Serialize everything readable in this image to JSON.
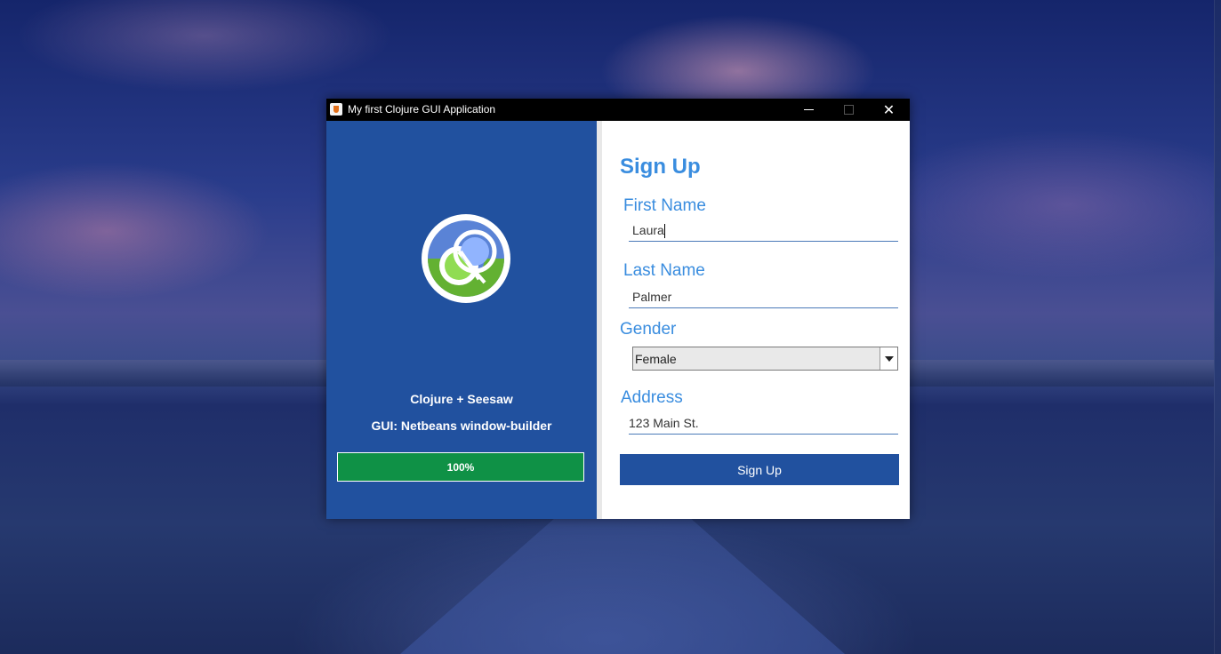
{
  "window": {
    "title": "My first Clojure GUI Application",
    "app_icon": "java-cup-icon",
    "controls": {
      "minimize_icon": "minimize-icon",
      "maximize_icon": "maximize-icon",
      "close_glyph": "✕"
    }
  },
  "left_panel": {
    "logo": "clojure-logo",
    "tagline_1": "Clojure + Seesaw",
    "tagline_2": "GUI: Netbeans window-builder",
    "progress": {
      "value": 100,
      "label": "100%"
    },
    "colors": {
      "background": "#21519f",
      "progress_fill": "#0f9146"
    }
  },
  "form": {
    "heading": "Sign Up",
    "first_name": {
      "label": "First Name",
      "value": "Laura"
    },
    "last_name": {
      "label": "Last Name",
      "value": "Palmer"
    },
    "gender": {
      "label": "Gender",
      "selected": "Female",
      "arrow_icon": "dropdown-arrow-icon"
    },
    "address": {
      "label": "Address",
      "value": "123 Main St."
    },
    "submit_label": "Sign Up",
    "colors": {
      "accent": "#3a8ddf",
      "button": "#21519f"
    }
  }
}
